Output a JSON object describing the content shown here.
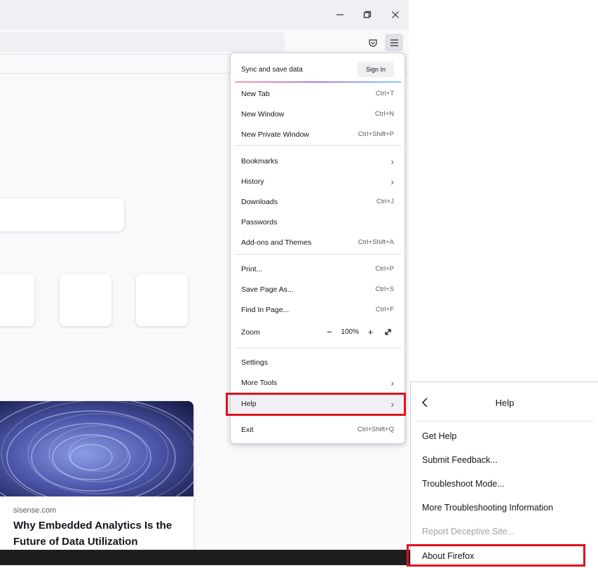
{
  "main_menu": {
    "sync_label": "Sync and save data",
    "sign_in_label": "Sign In",
    "items": [
      {
        "label": "New Tab",
        "shortcut": "Ctrl+T"
      },
      {
        "label": "New Window",
        "shortcut": "Ctrl+N"
      },
      {
        "label": "New Private Window",
        "shortcut": "Ctrl+Shift+P"
      },
      {
        "label": "Bookmarks"
      },
      {
        "label": "History"
      },
      {
        "label": "Downloads",
        "shortcut": "Ctrl+J"
      },
      {
        "label": "Passwords"
      },
      {
        "label": "Add-ons and Themes",
        "shortcut": "Ctrl+Shift+A"
      },
      {
        "label": "Print...",
        "shortcut": "Ctrl+P"
      },
      {
        "label": "Save Page As...",
        "shortcut": "Ctrl+S"
      },
      {
        "label": "Find In Page...",
        "shortcut": "Ctrl+F"
      },
      {
        "label": "Zoom"
      },
      {
        "label": "Settings"
      },
      {
        "label": "More Tools"
      },
      {
        "label": "Help"
      },
      {
        "label": "Exit",
        "shortcut": "Ctrl+Shift+Q"
      }
    ],
    "zoom": {
      "minus": "−",
      "value": "100%",
      "plus": "+"
    }
  },
  "help_menu": {
    "title": "Help",
    "items": [
      {
        "label": "Get Help"
      },
      {
        "label": "Submit Feedback..."
      },
      {
        "label": "Troubleshoot Mode..."
      },
      {
        "label": "More Troubleshooting Information"
      },
      {
        "label": "Report Deceptive Site...",
        "disabled": true
      },
      {
        "label": "About Firefox"
      }
    ]
  },
  "story": {
    "source": "sisense.com",
    "title": "Why Embedded Analytics Is the Future of Data Utilization"
  },
  "colors": {
    "highlight": "#e01020",
    "menu_bg": "#ffffff",
    "chrome_bg": "#f0f0f4"
  },
  "icons": [
    "minimize-icon",
    "restore-icon",
    "close-icon",
    "pocket-icon",
    "hamburger-menu-icon",
    "chevron-right-icon",
    "fullscreen-icon",
    "back-arrow-icon"
  ]
}
